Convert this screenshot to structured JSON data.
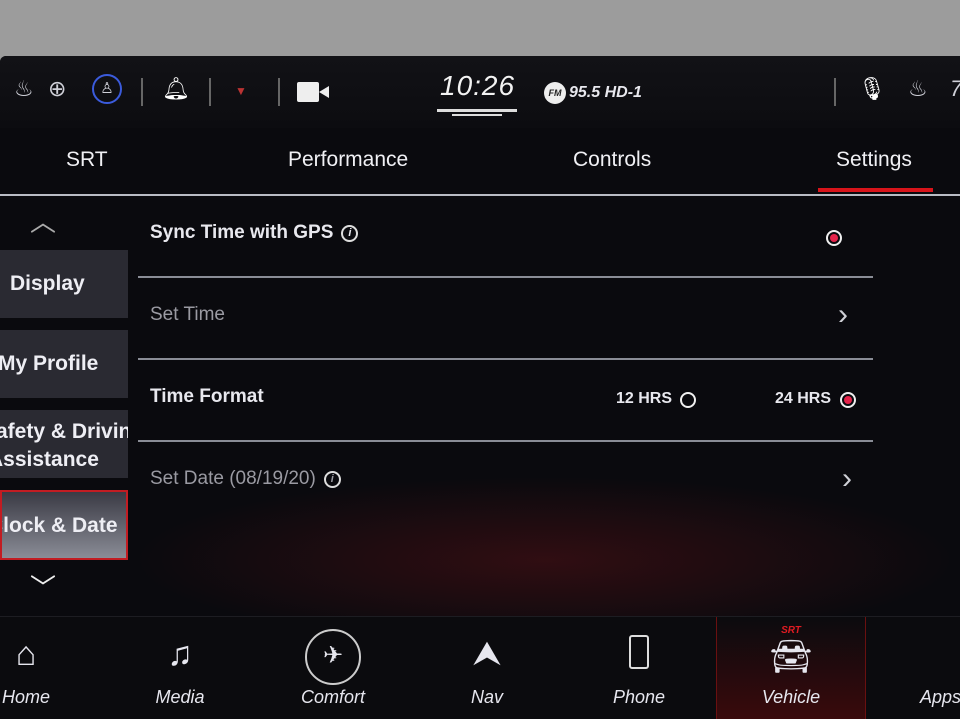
{
  "status": {
    "time": "10:26",
    "radio_band": "FM",
    "radio_station": "95.5 HD-1",
    "icons": [
      "heated-seat-icon",
      "heated-wheel-icon",
      "driver-profile-icon",
      "bell-icon",
      "wifi-icon",
      "camera-icon",
      "microphone-icon",
      "heated-seat-right-icon"
    ],
    "right_partial": "7"
  },
  "tabs": [
    {
      "label": "SRT"
    },
    {
      "label": "Performance"
    },
    {
      "label": "Controls"
    },
    {
      "label": "Settings",
      "active": true
    }
  ],
  "sidebar": {
    "items": [
      {
        "label": "Display"
      },
      {
        "label": "My Profile"
      },
      {
        "label": "Safety & Driving",
        "label2": "Assistance"
      },
      {
        "label": "Clock & Date",
        "active": true
      }
    ]
  },
  "settings": [
    {
      "label": "Sync Time with GPS",
      "info": "i",
      "selected": true
    },
    {
      "label": "Set Time",
      "enabled": false
    },
    {
      "label": "Time Format",
      "options": [
        {
          "label": "12 HRS",
          "selected": false
        },
        {
          "label": "24 HRS",
          "selected": true
        }
      ]
    },
    {
      "label": "Set Date (08/19/20)",
      "info": "i",
      "enabled": false
    }
  ],
  "nav": [
    {
      "label": "Home",
      "icon": "home-icon"
    },
    {
      "label": "Media",
      "icon": "music-note-icon"
    },
    {
      "label": "Comfort",
      "icon": "seat-comfort-icon"
    },
    {
      "label": "Nav",
      "icon": "navigation-arrow-icon"
    },
    {
      "label": "Phone",
      "icon": "phone-icon"
    },
    {
      "label": "Vehicle",
      "icon": "car-icon",
      "badge": "SRT",
      "active": true
    },
    {
      "label": "Apps",
      "icon": "apps-grid-icon"
    }
  ],
  "colors": {
    "accent": "#d8141a",
    "radio_on": "#e4234a"
  }
}
